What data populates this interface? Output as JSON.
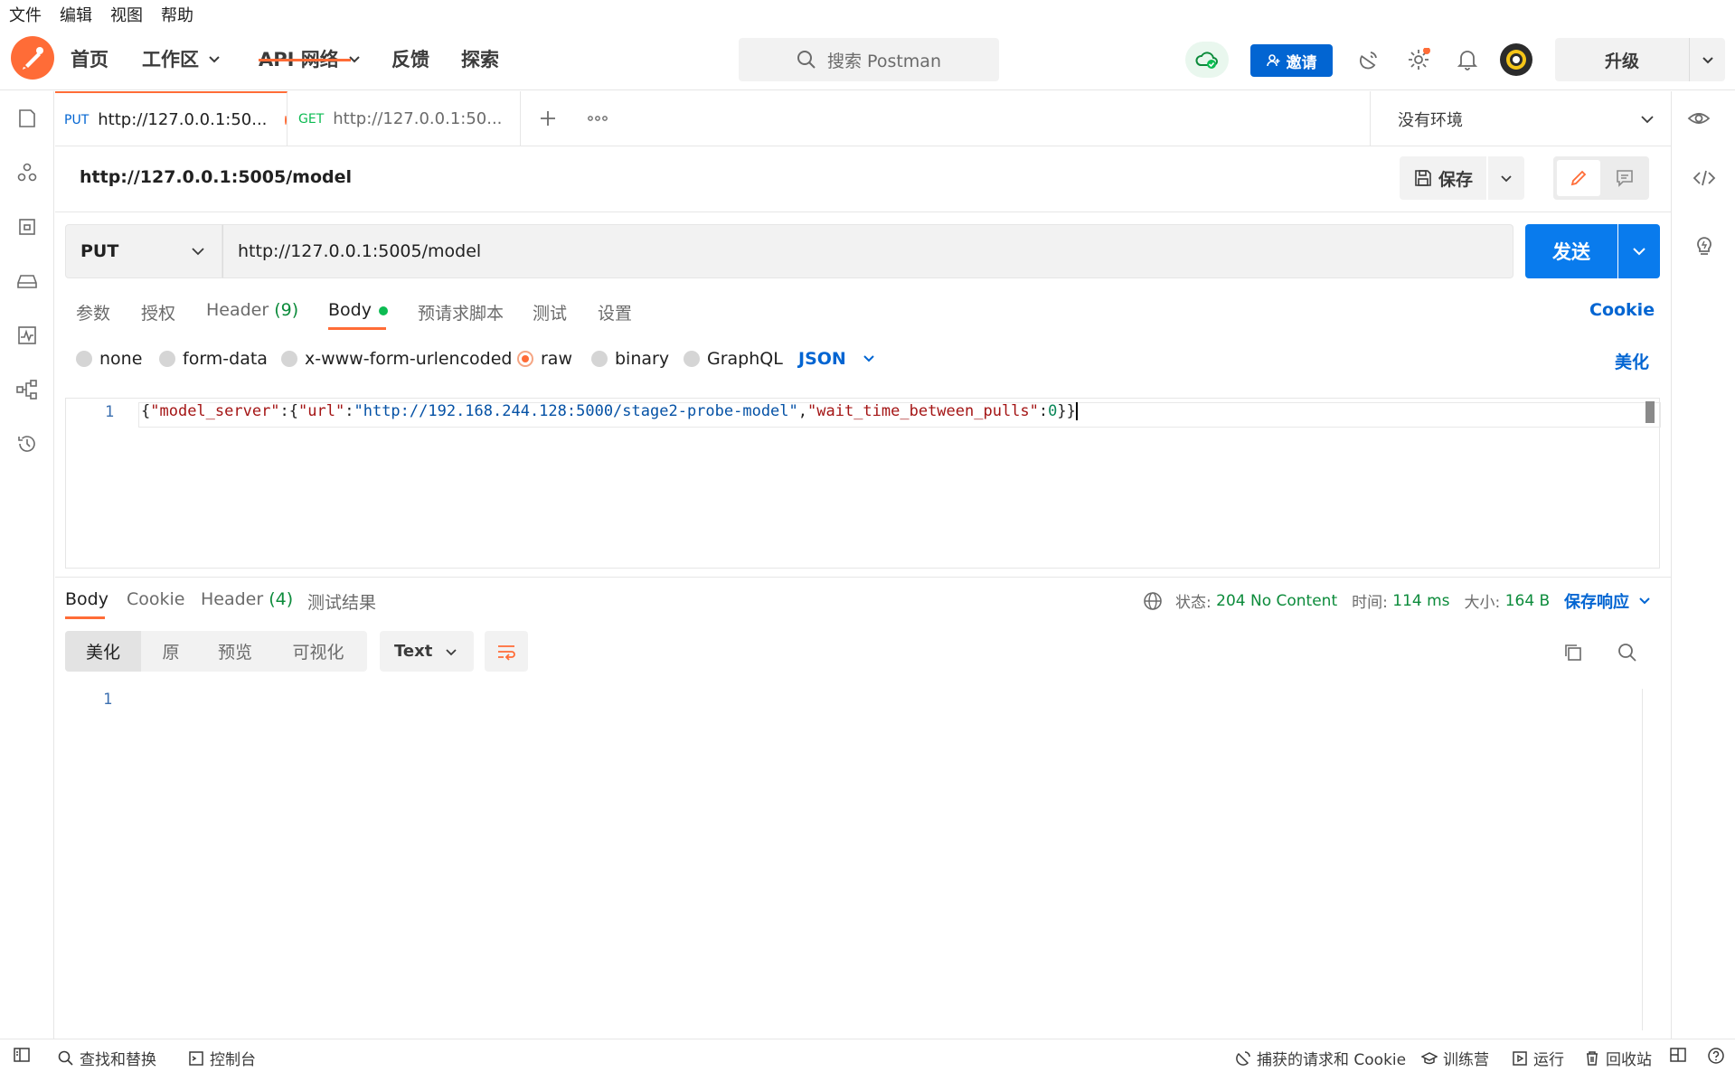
{
  "menubar": [
    "文件",
    "编辑",
    "视图",
    "帮助"
  ],
  "header": {
    "nav": [
      {
        "label": "首页",
        "dropdown": false
      },
      {
        "label": "工作区",
        "dropdown": true
      },
      {
        "label": "API 网络",
        "dropdown": true
      },
      {
        "label": "反馈",
        "dropdown": false
      },
      {
        "label": "探索",
        "dropdown": false
      }
    ],
    "search_placeholder": "搜索 Postman",
    "invite_label": "邀请",
    "upgrade_label": "升级"
  },
  "tabs": [
    {
      "method": "PUT",
      "method_color": "#0265d2",
      "title": "http://127.0.0.1:50...",
      "unsaved": true,
      "active": true
    },
    {
      "method": "GET",
      "method_color": "#0cbb52",
      "title": "http://127.0.0.1:50...",
      "unsaved": true,
      "active": false
    }
  ],
  "environment": "没有环境",
  "request": {
    "title": "http://127.0.0.1:5005/model",
    "save_label": "保存",
    "method": "PUT",
    "url": "http://127.0.0.1:5005/model",
    "send_label": "发送",
    "subtabs": {
      "params": "参数",
      "auth": "授权",
      "headers": "Header",
      "headers_count": "(9)",
      "body": "Body",
      "prescript": "预请求脚本",
      "tests": "测试",
      "settings": "设置"
    },
    "cookie_label": "Cookie",
    "body_types": [
      "none",
      "form-data",
      "x-www-form-urlencoded",
      "raw",
      "binary",
      "GraphQL"
    ],
    "selected_body_type": "raw",
    "format": "JSON",
    "beautify_label": "美化",
    "body_line_number": "1",
    "body_tokens": {
      "b1": "{",
      "k1": "\"model_server\"",
      "c1": ":",
      "b2": "{",
      "k2": "\"url\"",
      "c2": ":",
      "s1": "\"http://192.168.244.128:5000/stage2-probe-model\"",
      "c3": ",",
      "k3": "\"wait_time_between_pulls\"",
      "c4": ":",
      "n1": "0",
      "b3": "}}"
    }
  },
  "response": {
    "tabs": {
      "body": "Body",
      "cookie": "Cookie",
      "headers": "Header",
      "headers_count": "(4)",
      "tests": "测试结果"
    },
    "status_label": "状态:",
    "status_value": "204 No Content",
    "time_label": "时间:",
    "time_value": "114 ms",
    "size_label": "大小:",
    "size_value": "164 B",
    "save_response_label": "保存响应",
    "views": [
      "美化",
      "原",
      "预览",
      "可视化"
    ],
    "text_format": "Text",
    "line_number": "1"
  },
  "footer": {
    "find_replace": "查找和替换",
    "console": "控制台",
    "capture": "捕获的请求和 Cookie",
    "bootcamp": "训练营",
    "runner": "运行",
    "trash": "回收站"
  },
  "colors": {
    "brand_orange": "#ff6c37",
    "primary_blue": "#0265d2",
    "send_blue": "#097bed",
    "success_green": "#0c8b3b"
  }
}
